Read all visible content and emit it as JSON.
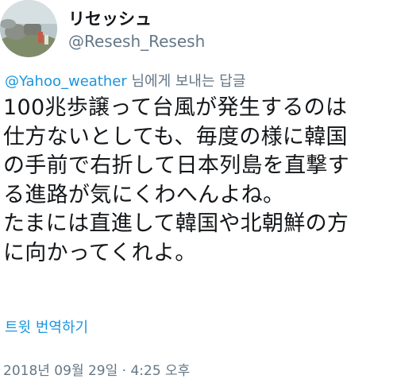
{
  "user": {
    "display_name": "リセッシュ",
    "handle": "@Resesh_Resesh"
  },
  "reply": {
    "mention": "@Yahoo_weather",
    "suffix": " 님에게 보내는 답글"
  },
  "tweet": {
    "text": "100兆歩譲って台風が発生するのは\n仕方ないとしても、毎度の様に韓国\nの手前で右折して日本列島を直撃す\nる進路が気にくわへんよね。\nたまには直進して韓国や北朝鮮の方\nに向かってくれよ。"
  },
  "translate_label": "트윗 번역하기",
  "timestamp": "2018년 09월 29일 · 4:25 오후",
  "colors": {
    "link": "#1b95e0",
    "secondary": "#657786",
    "text": "#14171a"
  }
}
